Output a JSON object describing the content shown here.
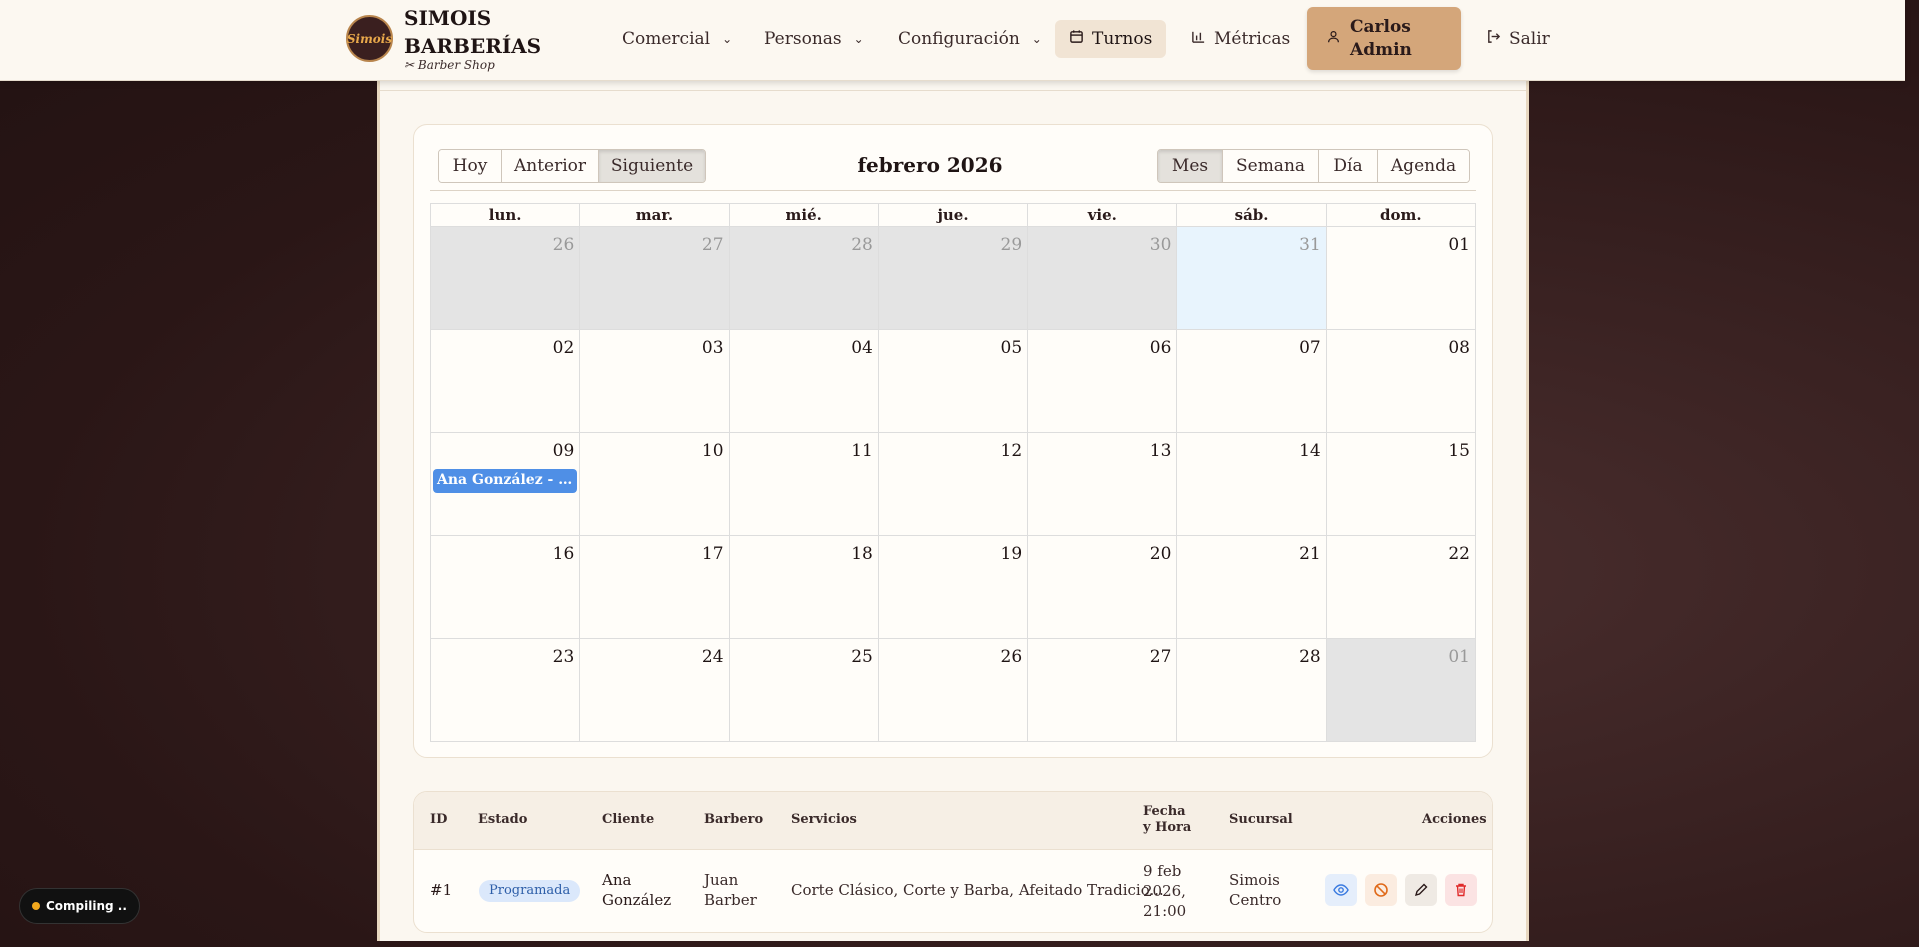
{
  "brand": {
    "logo_text": "Simois",
    "title": "SIMOIS BARBERÍAS",
    "subtitle": "Barber Shop"
  },
  "nav": {
    "items": [
      {
        "label": "Comercial",
        "has_dropdown": true
      },
      {
        "label": "Personas",
        "has_dropdown": true
      },
      {
        "label": "Configuración",
        "has_dropdown": true
      },
      {
        "label": "Turnos",
        "active": true
      },
      {
        "label": "Métricas"
      }
    ],
    "user": "Carlos Admin",
    "logout": "Salir"
  },
  "calendar": {
    "title": "febrero 2026",
    "nav_buttons": [
      "Hoy",
      "Anterior",
      "Siguiente"
    ],
    "view_buttons": [
      "Mes",
      "Semana",
      "Día",
      "Agenda"
    ],
    "selected_view": "Mes",
    "weekdays": [
      "lun.",
      "mar.",
      "mié.",
      "jue.",
      "vie.",
      "sáb.",
      "dom."
    ],
    "weeks": [
      [
        "26",
        "27",
        "28",
        "29",
        "30",
        "31",
        "01"
      ],
      [
        "02",
        "03",
        "04",
        "05",
        "06",
        "07",
        "08"
      ],
      [
        "09",
        "10",
        "11",
        "12",
        "13",
        "14",
        "15"
      ],
      [
        "16",
        "17",
        "18",
        "19",
        "20",
        "21",
        "22"
      ],
      [
        "23",
        "24",
        "25",
        "26",
        "27",
        "28",
        "01"
      ]
    ],
    "event": {
      "label": "Ana González - Co...",
      "color": "#4f8fe6"
    }
  },
  "table": {
    "headers": {
      "id": "ID",
      "estado": "Estado",
      "cliente": "Cliente",
      "barbero": "Barbero",
      "servicios": "Servicios",
      "fecha": "Fecha y Hora",
      "sucursal": "Sucursal",
      "acciones": "Acciones"
    },
    "row": {
      "id": "#1",
      "estado": "Programada",
      "cliente": "Ana González",
      "barbero": "Juan Barber",
      "servicios": "Corte Clásico, Corte y Barba, Afeitado Tradicio...",
      "fecha": "9 feb 2026, 21:00",
      "sucursal": "Simois Centro"
    }
  },
  "status": {
    "compiling": "Compiling .."
  }
}
